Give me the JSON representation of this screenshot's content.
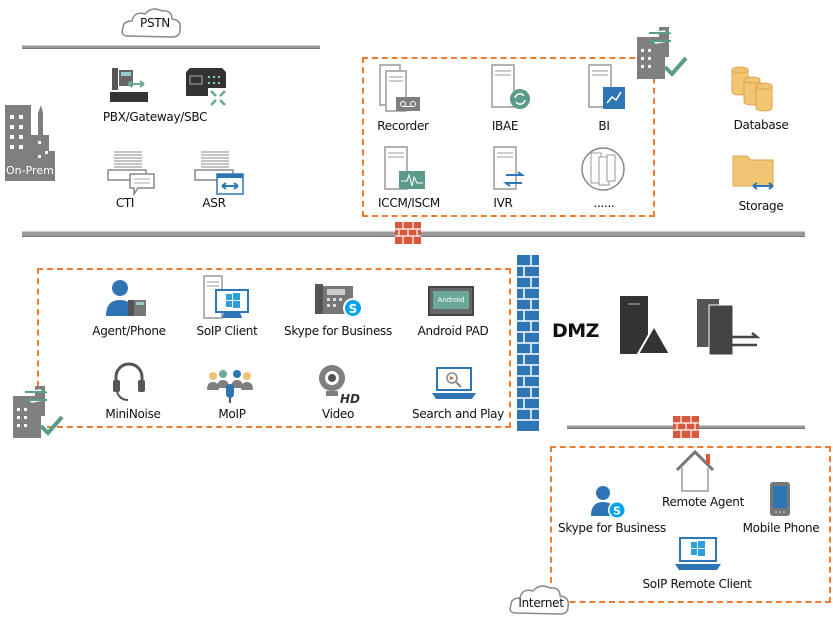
{
  "clouds": {
    "pstn": "PSTN",
    "internet": "Internet"
  },
  "on_prem": {
    "building_label": "On-Prem.",
    "pbx": "PBX/Gateway/SBC",
    "cti": "CTI",
    "asr": "ASR"
  },
  "servers": {
    "recorder": "Recorder",
    "ibae": "IBAE",
    "bi": "BI",
    "iccm": "ICCM/ISCM",
    "ivr": "IVR",
    "more": "......"
  },
  "storage": {
    "database": "Database",
    "storage": "Storage"
  },
  "clients": {
    "agent_phone": "Agent/Phone",
    "soip_client": "SoIP Client",
    "skype": "Skype for Business",
    "android_pad": "Android PAD",
    "android_screen": "Android",
    "mininoise": "MiniNoise",
    "moip": "MoIP",
    "video": "Video",
    "search_play": "Search and Play"
  },
  "dmz": "DMZ",
  "remote": {
    "remote_agent": "Remote Agent",
    "skype": "Skype for Business",
    "mobile_phone": "Mobile Phone",
    "soip_remote": "SoIP Remote Client"
  },
  "colors": {
    "dashed_border": "#ee7d31",
    "firewall": "#d9573c",
    "accent_blue": "#2e75b6",
    "icon_gray": "#7f7f7f",
    "check_green": "#5b9b8a",
    "db_gold": "#f2c574"
  }
}
